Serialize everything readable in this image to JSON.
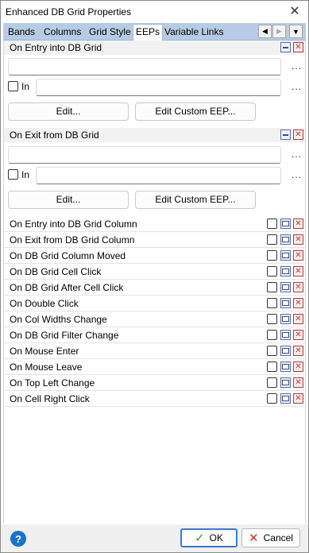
{
  "window": {
    "title": "Enhanced DB Grid Properties"
  },
  "tabs": [
    "Bands",
    "Columns",
    "Grid Style",
    "EEPs",
    "Variable Links"
  ],
  "active_tab": "EEPs",
  "entry_section": {
    "title": "On Entry into DB Grid",
    "in_label": "In",
    "edit_label": "Edit...",
    "custom_label": "Edit Custom EEP...",
    "dots": "..."
  },
  "exit_section": {
    "title": "On Exit from DB Grid",
    "in_label": "In",
    "edit_label": "Edit...",
    "custom_label": "Edit Custom EEP...",
    "dots": "..."
  },
  "events": [
    "On Entry into DB Grid Column",
    "On Exit from DB Grid Column",
    "On DB Grid Column Moved",
    "On DB Grid Cell Click",
    "On DB Grid After Cell Click",
    "On Double Click",
    "On Col Widths Change",
    "On DB Grid Filter Change",
    "On Mouse Enter",
    "On Mouse Leave",
    "On Top Left Change",
    "On Cell Right Click"
  ],
  "footer": {
    "help": "?",
    "ok": "OK",
    "cancel": "Cancel"
  },
  "colors": {
    "tab_strip": "#b8cbe4",
    "accent": "#3f78c9",
    "help": "#1a73c8"
  }
}
